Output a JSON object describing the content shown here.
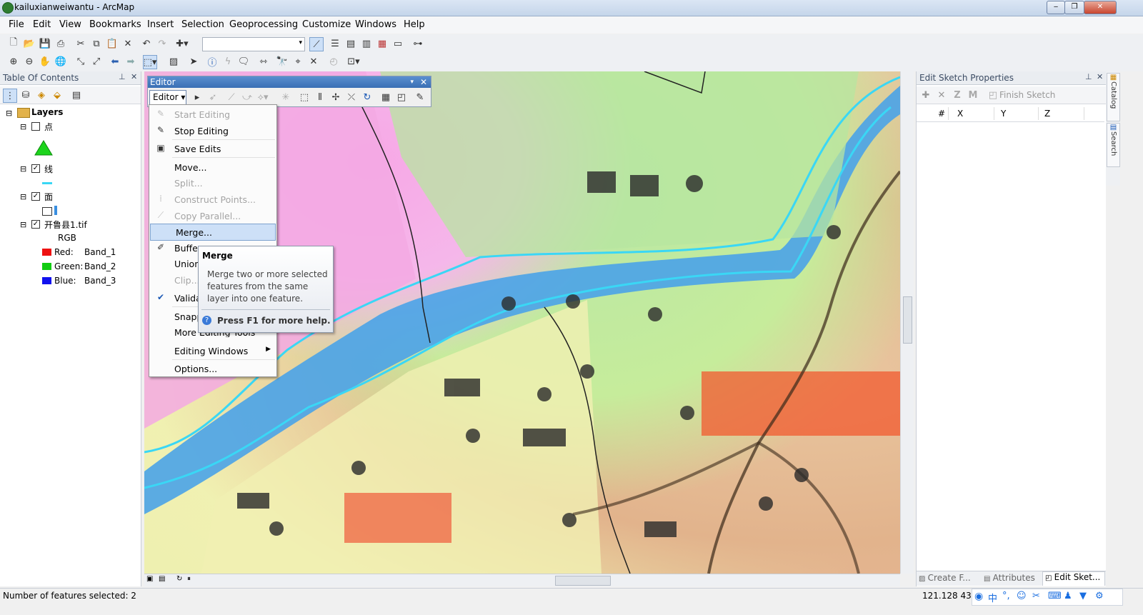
{
  "window": {
    "title": "kailuxianweiwantu - ArcMap"
  },
  "menu": [
    "File",
    "Edit",
    "View",
    "Bookmarks",
    "Insert",
    "Selection",
    "Geoprocessing",
    "Customize",
    "Windows",
    "Help"
  ],
  "toc": {
    "title": "Table Of Contents",
    "root": "Layers",
    "layers": [
      {
        "name": "点",
        "checked": false
      },
      {
        "name": "线",
        "checked": true
      },
      {
        "name": "面",
        "checked": true
      },
      {
        "name": "开鲁县1.tif",
        "checked": true
      }
    ],
    "raster": {
      "mode": "RGB",
      "bands": [
        {
          "label": "Red:",
          "band": "Band_1",
          "color": "#e11"
        },
        {
          "label": "Green:",
          "band": "Band_2",
          "color": "#1c1"
        },
        {
          "label": "Blue:",
          "band": "Band_3",
          "color": "#11e"
        }
      ]
    }
  },
  "editor": {
    "window_title": "Editor",
    "dropdown_label": "Editor ▾",
    "items": [
      {
        "label": "Start Editing",
        "enabled": false,
        "icon": "✎"
      },
      {
        "label": "Stop Editing",
        "enabled": true,
        "icon": "✎"
      },
      {
        "label": "Save Edits",
        "enabled": true,
        "icon": "▣"
      },
      {
        "label": "Move...",
        "enabled": true,
        "icon": ""
      },
      {
        "label": "Split...",
        "enabled": false,
        "icon": ""
      },
      {
        "label": "Construct Points...",
        "enabled": false,
        "icon": "⁞"
      },
      {
        "label": "Copy Parallel...",
        "enabled": false,
        "icon": "⟋"
      },
      {
        "label": "Merge...",
        "enabled": true,
        "icon": ""
      },
      {
        "label": "Buffer...",
        "enabled": true,
        "icon": "✐"
      },
      {
        "label": "Union...",
        "enabled": true,
        "icon": ""
      },
      {
        "label": "Clip...",
        "enabled": false,
        "icon": ""
      },
      {
        "label": "Validate Features",
        "enabled": true,
        "icon": "✔"
      },
      {
        "label": "Snapping",
        "enabled": true,
        "icon": ""
      },
      {
        "label": "More Editing Tools",
        "enabled": true,
        "icon": ""
      },
      {
        "label": "Editing Windows",
        "enabled": true,
        "icon": ""
      },
      {
        "label": "Options...",
        "enabled": true,
        "icon": ""
      }
    ],
    "visible_labels": {
      "buffer": "Buffer",
      "union": "Union",
      "clip": "Clip...",
      "validate": "Valida",
      "snapping": "Snapp",
      "more": "More Editing Tools"
    }
  },
  "tooltip": {
    "title": "Merge",
    "body": "Merge two or more selected features from the same layer into one feature.",
    "help": "Press F1 for more help."
  },
  "sketch": {
    "title": "Edit Sketch Properties",
    "finish": "Finish Sketch",
    "columns": [
      "#",
      "X",
      "Y",
      "Z"
    ],
    "side_tabs": [
      "Catalog",
      "Search"
    ]
  },
  "bottom_tabs": [
    "Create F...",
    "Attributes",
    "Edit Sket..."
  ],
  "status": {
    "text": "Number of features selected: 2",
    "coords": "121.128  43"
  },
  "colors": {
    "river": "#3ad7f5",
    "accent": "#3a6fb4"
  }
}
